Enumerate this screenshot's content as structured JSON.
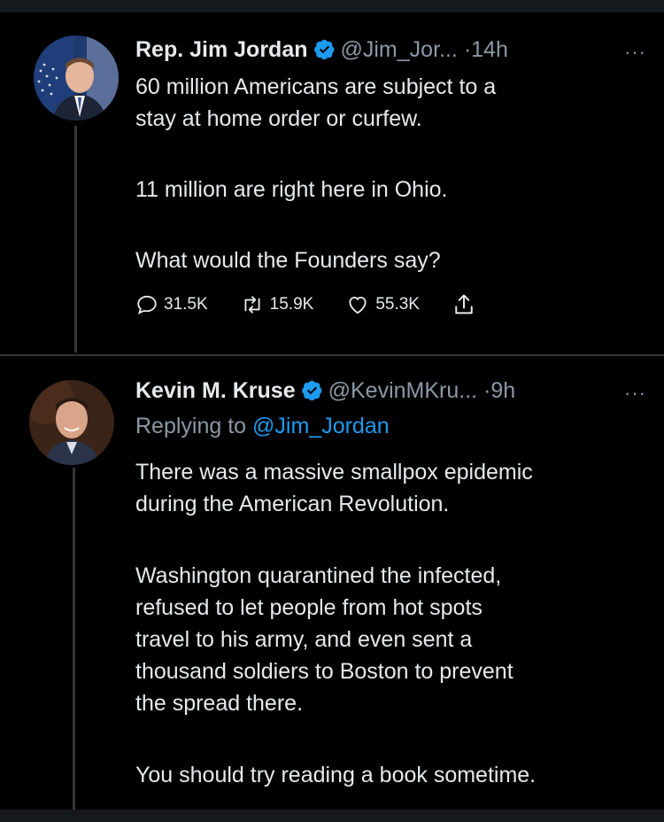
{
  "tweets": [
    {
      "name": "Rep. Jim Jordan",
      "handle": "@Jim_Jor...",
      "dot": "·",
      "time": "14h",
      "more": "···",
      "body": [
        "60 million Americans are subject to a",
        "stay at home order or curfew.",
        "",
        "11 million are right here in Ohio.",
        "",
        "What would the Founders say?"
      ],
      "actions": {
        "replies": "31.5K",
        "retweets": "15.9K",
        "likes": "55.3K"
      }
    },
    {
      "name": "Kevin M. Kruse",
      "handle": "@KevinMKru...",
      "dot": "·",
      "time": "9h",
      "more": "···",
      "replying_prefix": "Replying to",
      "replying_to": "@Jim_Jordan",
      "body": [
        "There was a massive smallpox epidemic",
        "during the American Revolution.",
        "",
        "Washington quarantined the infected,",
        "refused to let people from hot spots",
        "travel to his army, and even sent a",
        "thousand soldiers to Boston to prevent",
        "the spread there.",
        "",
        "You should try reading a book sometime."
      ]
    }
  ],
  "colors": {
    "background": "#000000",
    "text": "#e7e9ea",
    "muted": "#8b98a5",
    "link": "#1d9bf0",
    "verified": "#1d9bf0"
  },
  "icons": [
    "verified-badge-icon",
    "reply-icon",
    "retweet-icon",
    "like-icon",
    "share-icon",
    "more-icon"
  ]
}
